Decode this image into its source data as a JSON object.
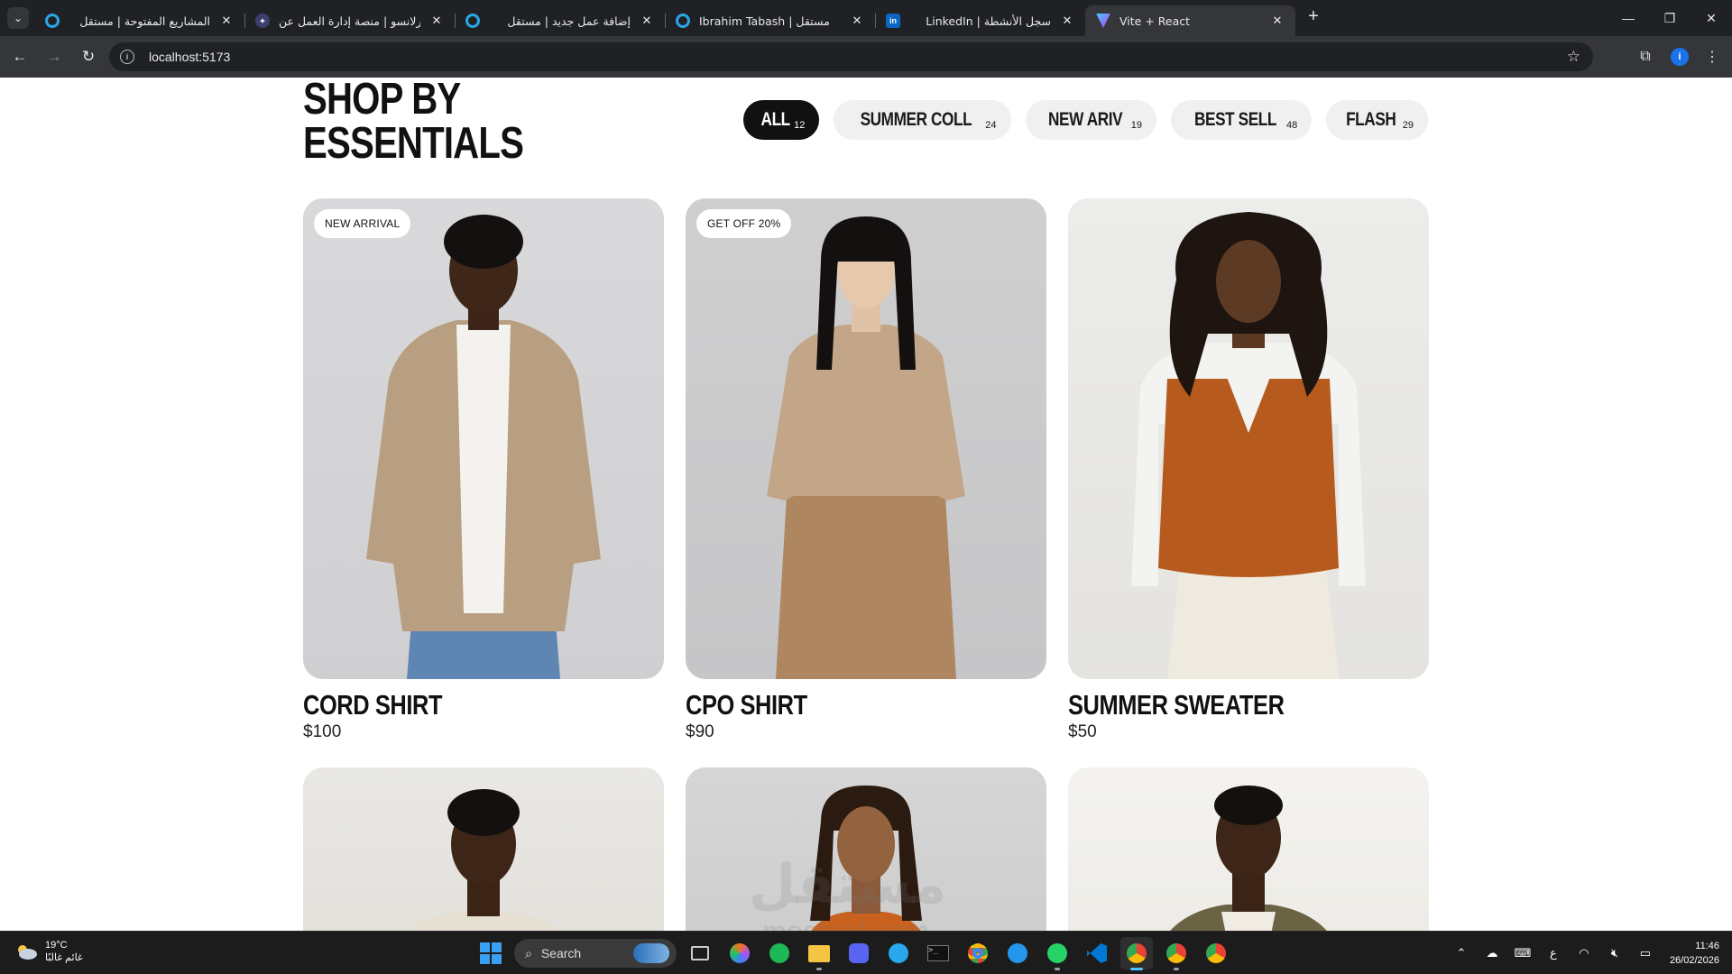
{
  "browser": {
    "tabs": [
      {
        "title": "المشاريع المفتوحة | مستقل",
        "icon": "mostaql-icon",
        "color": "#2aa6e8"
      },
      {
        "title": "فورلانسو | منصة إدارة العمل عن",
        "icon": "forlanso-icon",
        "color": "#7b6cd9"
      },
      {
        "title": "إضافة عمل جديد | مستقل",
        "icon": "mostaql-icon",
        "color": "#2aa6e8"
      },
      {
        "title": "Ibrahim Tabash | مستقل",
        "icon": "mostaql-icon",
        "color": "#2aa6e8"
      },
      {
        "title": "LinkedIn | سجل الأنشطة",
        "icon": "linkedin-icon",
        "color": "#0a66c2"
      },
      {
        "title": "Vite + React",
        "icon": "vite-icon",
        "color": "#a855f7",
        "active": true
      }
    ],
    "url": "localhost:5173"
  },
  "page": {
    "title_line1": "SHOP BY",
    "title_line2": "ESSENTIALS",
    "filters": [
      {
        "label": "ALL",
        "count": "12",
        "active": true
      },
      {
        "label": "SUMMER COLL",
        "count": "24"
      },
      {
        "label": "NEW ARIV",
        "count": "19"
      },
      {
        "label": "BEST SELL",
        "count": "48"
      },
      {
        "label": "FLASH",
        "count": "29"
      }
    ],
    "products": [
      {
        "name": "CORD SHIRT",
        "price": "$100",
        "badge": "NEW ARRIVAL"
      },
      {
        "name": "CPO SHIRT",
        "price": "$90",
        "badge": "GET OFF 20%"
      },
      {
        "name": "SUMMER SWEATER",
        "price": "$50",
        "badge": ""
      }
    ],
    "watermark": "مستقل",
    "watermark_sub": "mostaql.com"
  },
  "taskbar": {
    "weather_temp": "19°C",
    "weather_desc": "غائم غالبًا",
    "search_label": "Search",
    "time": "11:46",
    "date": "26/02/2026",
    "lang": "ع"
  }
}
